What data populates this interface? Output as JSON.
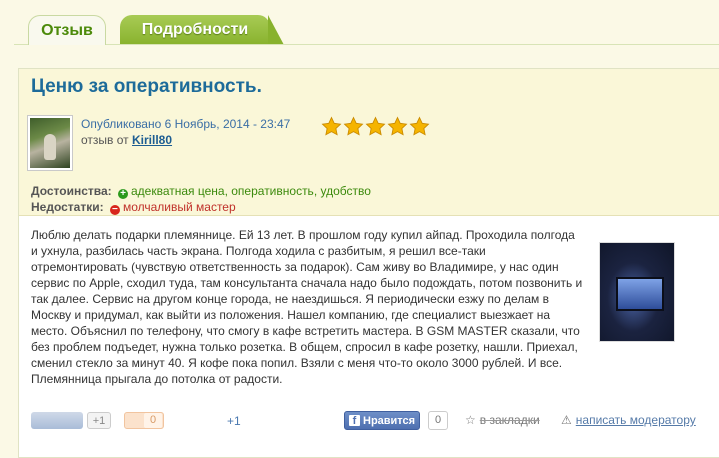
{
  "tabs": [
    {
      "label": "Отзыв",
      "active": true
    },
    {
      "label": "Подробности",
      "active": false
    }
  ],
  "review": {
    "title": "Ценю за оперативность.",
    "published_label": "Опубликовано",
    "published_date": "6 Ноябрь, 2014 - 23:47",
    "by_label": "отзыв от",
    "author": "Kirill80",
    "rating": 5,
    "rating_max": 5,
    "pros_label": "Достоинства:",
    "pros": "адекватная цена, оперативность, удобство",
    "cons_label": "Недостатки:",
    "cons": "молчаливый мастер",
    "body": "Люблю делать подарки племяннице. Ей 13 лет. В прошлом году купил айпад. Проходила полгода и ухнула, разбилась часть экрана. Полгода ходила с разбитым, я решил все-таки отремонтировать (чувствую ответственность за подарок). Сам живу во Владимире, у нас один сервис по Apple, сходил туда, там консультанта сначала надо было подождать, потом позвонить и так далее. Сервис на другом конце города, не наездишься. Я периодически езжу по делам в Москву и придумал, как выйти из положения. Нашел компанию, где специалист выезжает на место. Объяснил по телефону, что смогу в кафе встретить мастера. В GSM MASTER сказали, что без проблем подъедет, нужна только розетка. В общем, спросил в кафе розетку, нашли. Приехал, сменил стекло за минут 40. Я кофе пока попил. Взяли с меня что-то около 3000 рублей. И все. Племянница прыгала до потолка от радости."
  },
  "actions": {
    "vote_count": "+1",
    "orange_count": "0",
    "plus_one": "+1",
    "like_label": "Нравится",
    "like_count": "0",
    "bookmark_label": "в закладки",
    "moderator_label": "написать модератору"
  },
  "colors": {
    "tab_green": "#88b22d",
    "title_blue": "#1d6b9a",
    "star_gold": "#f5b400",
    "pros_green": "#3c8a0d",
    "cons_red": "#c0312a"
  }
}
